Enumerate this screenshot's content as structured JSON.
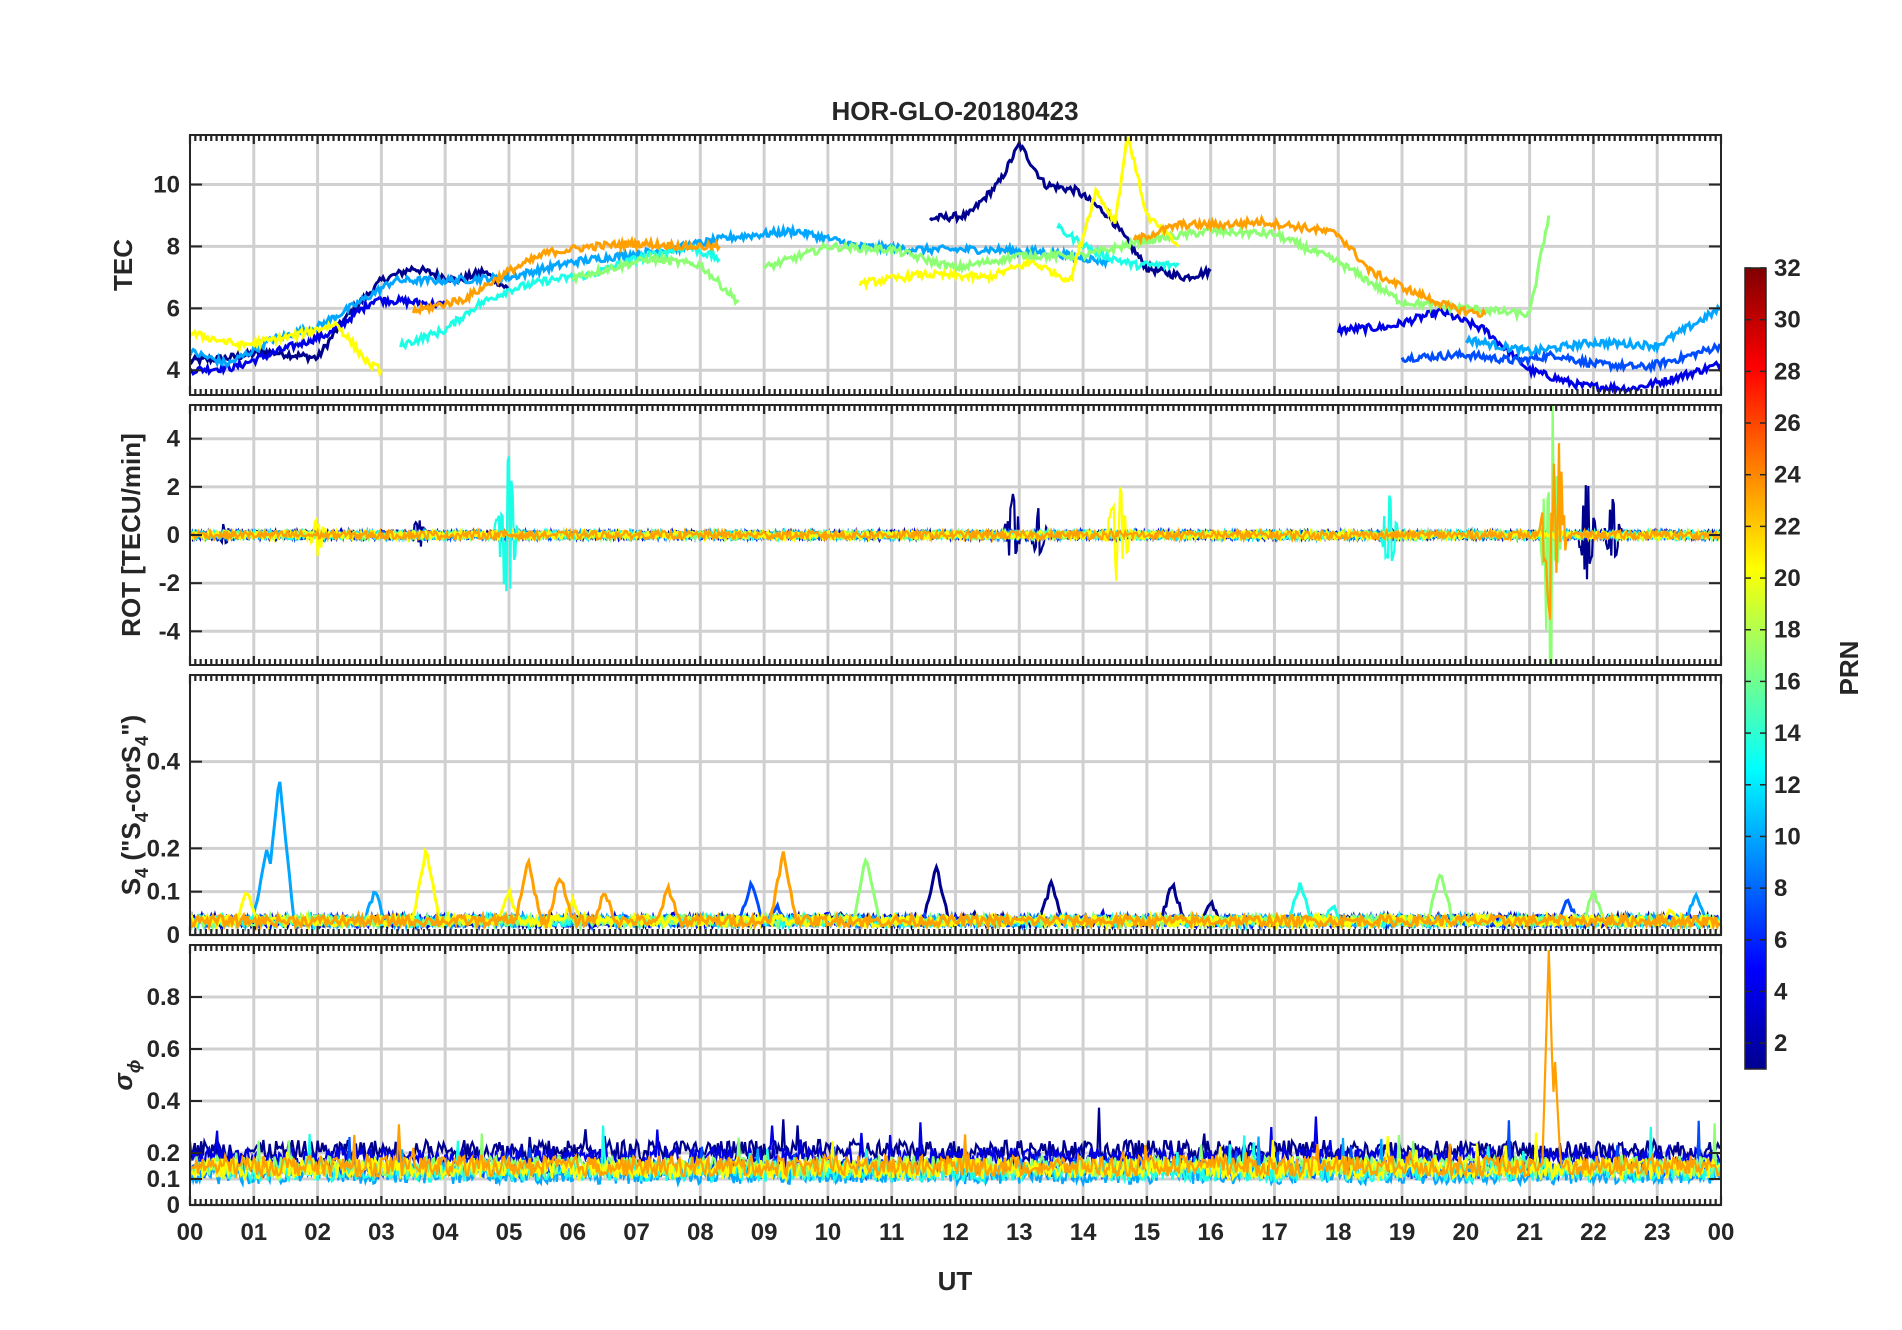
{
  "chart_data": {
    "type": "line",
    "title": "HOR-GLO-20180423",
    "xlabel": "UT",
    "x_tick_labels": [
      "00",
      "01",
      "02",
      "03",
      "04",
      "05",
      "06",
      "07",
      "08",
      "09",
      "10",
      "11",
      "12",
      "13",
      "14",
      "15",
      "16",
      "17",
      "18",
      "19",
      "20",
      "21",
      "22",
      "23",
      "00"
    ],
    "xlim": [
      0,
      24
    ],
    "grid": true,
    "panels": [
      {
        "id": "tec",
        "ylabel": "TEC",
        "ylim": [
          3.2,
          11.6
        ],
        "yticks": [
          4,
          6,
          8,
          10
        ],
        "ytick_labels": [
          "4",
          "6",
          "8",
          "10"
        ]
      },
      {
        "id": "rot",
        "ylabel": "ROT [TECU/min]",
        "ylim": [
          -5.4,
          5.4
        ],
        "yticks": [
          -4,
          -2,
          0,
          2,
          4
        ],
        "ytick_labels": [
          "-4",
          "-2",
          "0",
          "2",
          "4"
        ]
      },
      {
        "id": "s4",
        "ylabel_main": "S",
        "ylabel_sub": "4",
        "ylabel_rest": " (\"S",
        "ylabel_sub2": "4",
        "ylabel_rest2": "-corS",
        "ylabel_sub3": "4",
        "ylabel_end": "\")",
        "ylim": [
          0,
          0.6
        ],
        "yticks": [
          0,
          0.1,
          0.2,
          0.4
        ],
        "ytick_labels": [
          "0",
          "0.1",
          "0.2",
          "0.4"
        ]
      },
      {
        "id": "sigma",
        "ylabel_main": "σ",
        "ylabel_sub": "ϕ",
        "ylim": [
          0,
          1
        ],
        "yticks": [
          0,
          0.1,
          0.2,
          0.4,
          0.6,
          0.8
        ],
        "ytick_labels": [
          "0",
          "0.1",
          "0.2",
          "0.4",
          "0.6",
          "0.8"
        ]
      }
    ],
    "colorbar": {
      "label": "PRN",
      "range": [
        1,
        32
      ],
      "ticks": [
        2,
        4,
        6,
        8,
        10,
        12,
        14,
        16,
        18,
        20,
        22,
        24,
        26,
        28,
        30,
        32
      ],
      "tick_labels": [
        "2",
        "4",
        "6",
        "8",
        "10",
        "12",
        "14",
        "16",
        "18",
        "20",
        "22",
        "24",
        "26",
        "28",
        "30",
        "32"
      ],
      "colormap": "jet"
    },
    "series": [
      {
        "prn": 1,
        "color": "#00008f",
        "tec": [
          [
            0.0,
            4.3
          ],
          [
            0.6,
            4.4
          ],
          [
            1.2,
            4.6
          ],
          [
            2.0,
            4.4
          ],
          [
            2.4,
            5.6
          ],
          [
            3.0,
            6.9
          ],
          [
            3.5,
            7.3
          ],
          [
            4.2,
            6.9
          ],
          [
            4.6,
            7.2
          ],
          [
            5.0,
            6.6
          ]
        ],
        "tec2": [
          [
            11.6,
            8.9
          ],
          [
            12.2,
            9.0
          ],
          [
            12.7,
            10.1
          ],
          [
            13.0,
            11.3
          ],
          [
            13.4,
            10.0
          ],
          [
            13.9,
            9.8
          ],
          [
            14.4,
            9.0
          ],
          [
            15.0,
            7.3
          ],
          [
            15.6,
            7.0
          ],
          [
            16.0,
            7.2
          ]
        ],
        "rot_events": [
          [
            0.5,
            0.4
          ],
          [
            3.6,
            0.6
          ],
          [
            12.9,
            1.6
          ],
          [
            13.3,
            1.0
          ],
          [
            21.9,
            2.2
          ],
          [
            22.3,
            1.4
          ]
        ],
        "s4_events": [
          [
            10.2,
            0.05
          ],
          [
            11.7,
            0.16
          ],
          [
            12.3,
            0.05
          ],
          [
            13.5,
            0.12
          ],
          [
            15.4,
            0.12
          ],
          [
            16.0,
            0.08
          ]
        ],
        "sigma_base": 0.21
      },
      {
        "prn": 4,
        "color": "#0000e6",
        "tec": [
          [
            0.0,
            4.0
          ],
          [
            0.7,
            4.1
          ],
          [
            1.5,
            4.7
          ],
          [
            2.2,
            5.2
          ],
          [
            2.9,
            6.3
          ],
          [
            3.5,
            6.2
          ],
          [
            4.0,
            6.1
          ]
        ],
        "tec2": [
          [
            18.0,
            5.3
          ],
          [
            18.8,
            5.4
          ],
          [
            19.6,
            5.9
          ],
          [
            20.3,
            5.3
          ],
          [
            21.0,
            4.0
          ],
          [
            21.8,
            3.5
          ],
          [
            22.6,
            3.4
          ],
          [
            23.2,
            3.7
          ],
          [
            24.0,
            4.2
          ]
        ],
        "s4_events": [
          [
            7.6,
            0.05
          ],
          [
            10.0,
            0.05
          ],
          [
            14.3,
            0.05
          ]
        ],
        "sigma_base": 0.18
      },
      {
        "prn": 7,
        "color": "#004dff",
        "tec": [
          [
            19.0,
            4.4
          ],
          [
            20.0,
            4.5
          ],
          [
            20.8,
            4.3
          ],
          [
            21.4,
            4.5
          ],
          [
            22.0,
            4.2
          ],
          [
            22.8,
            4.1
          ],
          [
            23.4,
            4.4
          ],
          [
            24.0,
            4.8
          ]
        ],
        "s4_events": [
          [
            8.8,
            0.12
          ],
          [
            9.2,
            0.07
          ],
          [
            21.6,
            0.08
          ]
        ],
        "sigma_base": 0.14
      },
      {
        "prn": 10,
        "color": "#00a6ff",
        "tec": [
          [
            0.0,
            4.6
          ],
          [
            0.6,
            4.2
          ],
          [
            1.3,
            5.0
          ],
          [
            2.0,
            5.4
          ],
          [
            2.5,
            6.0
          ],
          [
            3.2,
            6.9
          ],
          [
            4.0,
            6.9
          ],
          [
            5.0,
            7.0
          ],
          [
            6.0,
            7.5
          ],
          [
            7.5,
            7.9
          ],
          [
            8.5,
            8.3
          ],
          [
            9.5,
            8.5
          ],
          [
            10.5,
            8.0
          ],
          [
            11.5,
            7.9
          ],
          [
            12.5,
            7.9
          ],
          [
            13.5,
            7.8
          ],
          [
            14.4,
            7.5
          ]
        ],
        "tec2": [
          [
            20.0,
            5.0
          ],
          [
            21.0,
            4.6
          ],
          [
            22.0,
            4.9
          ],
          [
            23.0,
            4.8
          ],
          [
            24.0,
            6.0
          ]
        ],
        "s4_events": [
          [
            1.2,
            0.2
          ],
          [
            1.4,
            0.37
          ],
          [
            2.9,
            0.1
          ],
          [
            23.6,
            0.09
          ]
        ],
        "sigma_base": 0.12
      },
      {
        "prn": 13,
        "color": "#1affe6",
        "tec": [
          [
            3.3,
            4.8
          ],
          [
            4.0,
            5.3
          ],
          [
            4.5,
            6.1
          ],
          [
            5.0,
            6.6
          ],
          [
            5.6,
            6.9
          ],
          [
            6.3,
            7.1
          ],
          [
            7.0,
            7.6
          ],
          [
            7.8,
            8.0
          ],
          [
            8.3,
            7.6
          ]
        ],
        "tec2": [
          [
            13.6,
            8.6
          ],
          [
            14.2,
            7.8
          ],
          [
            14.8,
            7.4
          ],
          [
            15.5,
            7.4
          ]
        ],
        "rot_events": [
          [
            5.0,
            2.8
          ],
          [
            4.9,
            1.6
          ],
          [
            18.8,
            1.6
          ]
        ],
        "s4_events": [
          [
            17.4,
            0.12
          ],
          [
            17.9,
            0.07
          ]
        ],
        "sigma_base": 0.13
      },
      {
        "prn": 17,
        "color": "#8cff73",
        "tec": [
          [
            6.0,
            7.0
          ],
          [
            7.2,
            7.6
          ],
          [
            8.0,
            7.4
          ],
          [
            8.6,
            6.2
          ]
        ],
        "tec2": [
          [
            9.0,
            7.3
          ],
          [
            10.0,
            8.0
          ],
          [
            11.0,
            7.9
          ],
          [
            12.0,
            7.3
          ],
          [
            13.0,
            7.7
          ],
          [
            14.0,
            7.7
          ],
          [
            15.0,
            8.2
          ],
          [
            16.0,
            8.5
          ],
          [
            17.0,
            8.4
          ],
          [
            18.0,
            7.5
          ],
          [
            19.0,
            6.2
          ],
          [
            20.0,
            6.0
          ],
          [
            21.0,
            5.8
          ],
          [
            21.3,
            9.0
          ]
        ],
        "rot_events": [
          [
            21.3,
            4.3
          ],
          [
            21.35,
            -4.0
          ]
        ],
        "s4_events": [
          [
            10.6,
            0.18
          ],
          [
            19.6,
            0.15
          ],
          [
            22.0,
            0.1
          ]
        ],
        "sigma_base": 0.15
      },
      {
        "prn": 20,
        "color": "#ffff00",
        "tec": [
          [
            0.0,
            5.2
          ],
          [
            0.8,
            4.8
          ],
          [
            1.6,
            5.1
          ],
          [
            2.3,
            5.5
          ],
          [
            2.8,
            4.2
          ],
          [
            3.0,
            4.0
          ]
        ],
        "tec2": [
          [
            10.5,
            6.8
          ],
          [
            11.5,
            7.1
          ],
          [
            12.5,
            7.0
          ],
          [
            13.2,
            7.5
          ],
          [
            13.8,
            6.9
          ],
          [
            14.2,
            9.8
          ],
          [
            14.5,
            8.8
          ],
          [
            14.7,
            11.6
          ],
          [
            15.0,
            9.0
          ],
          [
            15.5,
            8.0
          ]
        ],
        "rot_events": [
          [
            2.0,
            -0.8
          ],
          [
            14.5,
            1.8
          ],
          [
            14.6,
            -1.6
          ]
        ],
        "s4_events": [
          [
            0.9,
            0.1
          ],
          [
            3.7,
            0.2
          ],
          [
            5.0,
            0.1
          ],
          [
            6.0,
            0.08
          ],
          [
            23.2,
            0.06
          ]
        ],
        "sigma_base": 0.14
      },
      {
        "prn": 23,
        "color": "#ff9f00",
        "tec": [
          [
            3.5,
            5.9
          ],
          [
            4.3,
            6.3
          ],
          [
            5.0,
            7.2
          ],
          [
            5.6,
            7.8
          ],
          [
            6.3,
            8.0
          ],
          [
            7.0,
            8.1
          ],
          [
            7.8,
            8.0
          ],
          [
            8.3,
            8.0
          ]
        ],
        "tec2": [
          [
            14.8,
            8.2
          ],
          [
            15.5,
            8.7
          ],
          [
            16.2,
            8.7
          ],
          [
            16.8,
            8.8
          ],
          [
            17.5,
            8.6
          ],
          [
            18.0,
            8.4
          ],
          [
            18.5,
            7.2
          ],
          [
            19.2,
            6.5
          ],
          [
            19.8,
            6.0
          ],
          [
            20.3,
            5.8
          ]
        ],
        "rot_events": [
          [
            21.3,
            2.4
          ],
          [
            21.4,
            -3.6
          ],
          [
            21.45,
            2.3
          ]
        ],
        "s4_events": [
          [
            5.3,
            0.17
          ],
          [
            5.8,
            0.14
          ],
          [
            6.5,
            0.1
          ],
          [
            7.5,
            0.11
          ],
          [
            9.3,
            0.19
          ]
        ],
        "sigma_spike": [
          [
            21.3,
            0.98
          ],
          [
            21.4,
            0.55
          ]
        ],
        "sigma_base": 0.15
      }
    ]
  }
}
